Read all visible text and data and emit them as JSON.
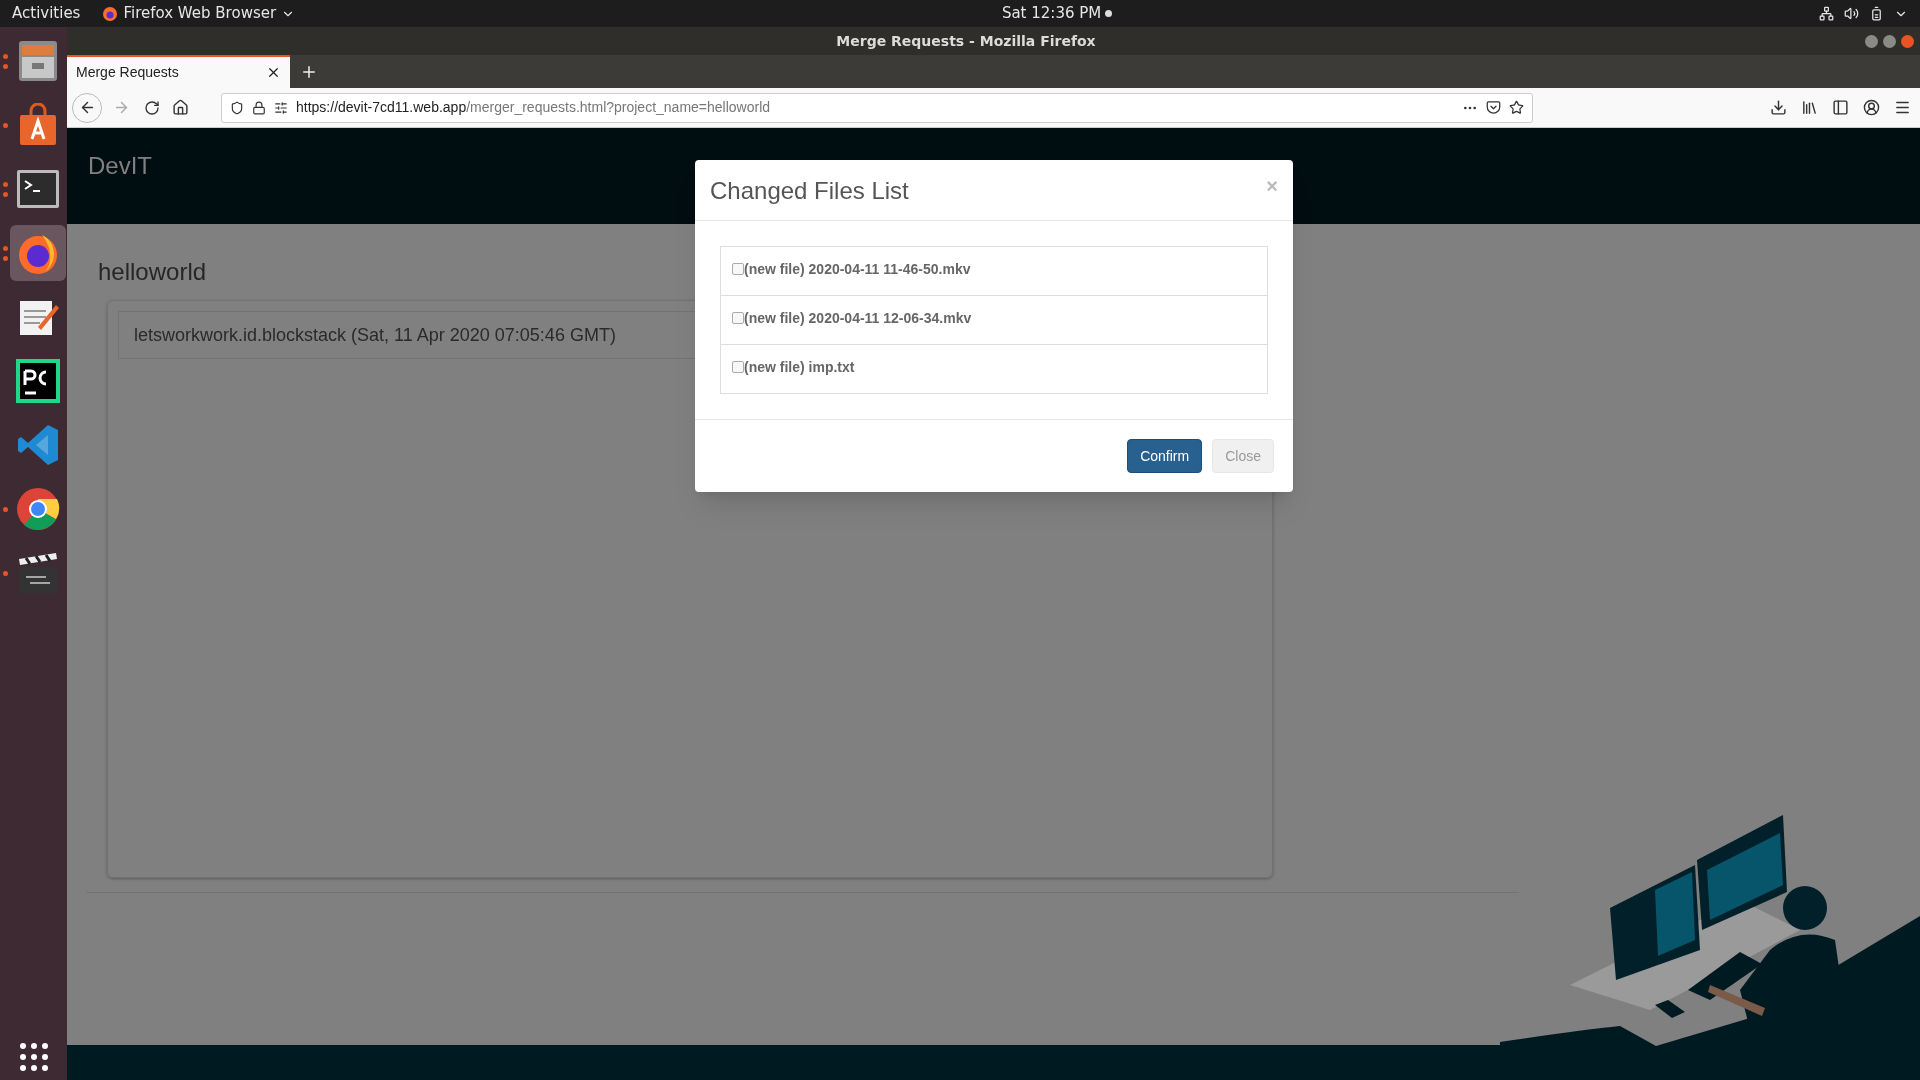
{
  "top_bar": {
    "activities": "Activities",
    "app_menu": "Firefox Web Browser",
    "clock": "Sat 12:36 PM"
  },
  "dock": {
    "items": [
      {
        "running": true,
        "multiple_windows": true,
        "selected": false
      },
      {
        "running": true,
        "multiple_windows": false,
        "selected": false
      },
      {
        "running": true,
        "multiple_windows": true,
        "selected": false
      },
      {
        "running": true,
        "multiple_windows": true,
        "selected": true
      },
      {
        "running": false,
        "selected": false
      },
      {
        "running": false,
        "selected": false
      },
      {
        "running": false,
        "selected": false
      },
      {
        "running": true,
        "multiple_windows": false,
        "selected": false
      },
      {
        "running": true,
        "multiple_windows": false,
        "selected": false
      }
    ]
  },
  "window": {
    "title": "Merge Requests - Mozilla Firefox"
  },
  "tabs": [
    {
      "label": "Merge Requests",
      "selected": true
    }
  ],
  "nav": {
    "forward_disabled": true
  },
  "url": {
    "host": "https://devit-7cd11.web.app",
    "path": "/merger_requests.html?project_name=helloworld"
  },
  "page": {
    "brand": "DevIT",
    "project": "helloworld",
    "merge_requests": [
      "letsworkwork.id.blockstack (Sat, 11 Apr 2020 07:05:46 GMT)"
    ]
  },
  "modal": {
    "title": "Changed Files List",
    "close_glyph": "×",
    "files": [
      {
        "label": "(new file) 2020-04-11 11-46-50.mkv",
        "checked": false
      },
      {
        "label": "(new file) 2020-04-11 12-06-34.mkv",
        "checked": false
      },
      {
        "label": "(new file) imp.txt",
        "checked": false
      }
    ],
    "buttons": [
      {
        "label": "Confirm",
        "kind": "primary"
      },
      {
        "label": "Close",
        "kind": "default"
      }
    ]
  }
}
